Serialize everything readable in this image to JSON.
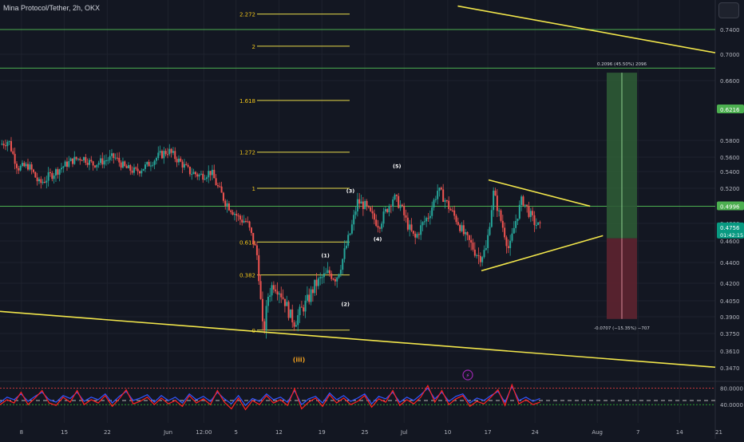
{
  "header": {
    "symbol": "Mina Protocol/Tether, 2h, OKX"
  },
  "colors": {
    "background": "#131722",
    "grid": "#1e222d",
    "green_line": "#4caf50",
    "yellow": "#f2e64b",
    "fib_line": "#e6d84a",
    "fib_text": "#f0c419",
    "candle_up": "#26a69a",
    "candle_down": "#ef5350",
    "profit_zone": "#2e5a35",
    "loss_zone": "#5e2430",
    "rsi_blue": "#3355ff",
    "rsi_red": "#ff2020",
    "axis_text": "#b2b5be"
  },
  "chart_data": [
    {
      "type": "candlestick",
      "title": "",
      "price_scale": {
        "ticks": [
          "0.7400",
          "0.7000",
          "0.6600",
          "0.5800",
          "0.5600",
          "0.5400",
          "0.5200",
          "0.4800",
          "0.4600",
          "0.4400",
          "0.4200",
          "0.4050",
          "0.3900",
          "0.3750",
          "0.3610",
          "0.3470"
        ],
        "badges": [
          {
            "label": "0.6216",
            "price": 0.6216,
            "color": "#4caf50"
          },
          {
            "label": "0.4996",
            "price": 0.4996,
            "color": "#4caf50"
          },
          {
            "label": "0.4756",
            "sub": "01:42:15",
            "price": 0.4756,
            "color": "#089981"
          }
        ]
      },
      "time_axis": {
        "ticks": [
          {
            "label": "8",
            "x": 0.03
          },
          {
            "label": "15",
            "x": 0.09
          },
          {
            "label": "22",
            "x": 0.15
          },
          {
            "label": "Jun",
            "x": 0.235
          },
          {
            "label": "12:00",
            "x": 0.285
          },
          {
            "label": "5",
            "x": 0.33
          },
          {
            "label": "12",
            "x": 0.39
          },
          {
            "label": "19",
            "x": 0.45
          },
          {
            "label": "25",
            "x": 0.51
          },
          {
            "label": "Jul",
            "x": 0.565
          },
          {
            "label": "10",
            "x": 0.626
          },
          {
            "label": "17",
            "x": 0.682
          },
          {
            "label": "24",
            "x": 0.748
          },
          {
            "label": "Aug",
            "x": 0.835
          },
          {
            "label": "7",
            "x": 0.892
          },
          {
            "label": "14",
            "x": 0.95
          },
          {
            "label": "21",
            "x": 1.005
          }
        ]
      },
      "price_path": [
        [
          0.0,
          0.575
        ],
        [
          0.012,
          0.58
        ],
        [
          0.025,
          0.545
        ],
        [
          0.04,
          0.548
        ],
        [
          0.055,
          0.525
        ],
        [
          0.07,
          0.535
        ],
        [
          0.085,
          0.545
        ],
        [
          0.1,
          0.555
        ],
        [
          0.115,
          0.56
        ],
        [
          0.13,
          0.55
        ],
        [
          0.145,
          0.555
        ],
        [
          0.16,
          0.56
        ],
        [
          0.175,
          0.545
        ],
        [
          0.19,
          0.54
        ],
        [
          0.205,
          0.548
        ],
        [
          0.22,
          0.56
        ],
        [
          0.235,
          0.568
        ],
        [
          0.25,
          0.555
        ],
        [
          0.265,
          0.54
        ],
        [
          0.28,
          0.535
        ],
        [
          0.295,
          0.54
        ],
        [
          0.305,
          0.52
        ],
        [
          0.315,
          0.505
        ],
        [
          0.325,
          0.495
        ],
        [
          0.335,
          0.485
        ],
        [
          0.345,
          0.482
        ],
        [
          0.36,
          0.445
        ],
        [
          0.368,
          0.372
        ],
        [
          0.375,
          0.41
        ],
        [
          0.382,
          0.42
        ],
        [
          0.39,
          0.415
        ],
        [
          0.398,
          0.405
        ],
        [
          0.405,
          0.392
        ],
        [
          0.412,
          0.385
        ],
        [
          0.42,
          0.395
        ],
        [
          0.43,
          0.405
        ],
        [
          0.44,
          0.418
        ],
        [
          0.45,
          0.425
        ],
        [
          0.46,
          0.43
        ],
        [
          0.47,
          0.425
        ],
        [
          0.48,
          0.445
        ],
        [
          0.49,
          0.47
        ],
        [
          0.5,
          0.505
        ],
        [
          0.51,
          0.5
        ],
        [
          0.52,
          0.488
        ],
        [
          0.53,
          0.478
        ],
        [
          0.54,
          0.495
        ],
        [
          0.55,
          0.51
        ],
        [
          0.56,
          0.5
        ],
        [
          0.57,
          0.478
        ],
        [
          0.58,
          0.462
        ],
        [
          0.59,
          0.478
        ],
        [
          0.6,
          0.49
        ],
        [
          0.612,
          0.518
        ],
        [
          0.62,
          0.51
        ],
        [
          0.63,
          0.495
        ],
        [
          0.64,
          0.482
        ],
        [
          0.65,
          0.465
        ],
        [
          0.66,
          0.455
        ],
        [
          0.67,
          0.445
        ],
        [
          0.68,
          0.452
        ],
        [
          0.69,
          0.515
        ],
        [
          0.698,
          0.49
        ],
        [
          0.705,
          0.47
        ],
        [
          0.712,
          0.45
        ],
        [
          0.72,
          0.48
        ],
        [
          0.73,
          0.508
        ],
        [
          0.738,
          0.495
        ],
        [
          0.746,
          0.482
        ],
        [
          0.755,
          0.475
        ]
      ],
      "green_lines": [
        0.74,
        0.679,
        0.4996
      ],
      "trendlines": [
        {
          "name": "upper-wedge-line",
          "from": [
            0.64,
            0.778
          ],
          "to": [
            1.0,
            0.7024
          ]
        },
        {
          "name": "lower-wedge-line",
          "from": [
            0.0,
            0.395
          ],
          "to": [
            1.0,
            0.3475
          ]
        },
        {
          "name": "triangle-upper",
          "from": [
            0.683,
            0.53
          ],
          "to": [
            0.825,
            0.4996
          ]
        },
        {
          "name": "triangle-lower",
          "from": [
            0.673,
            0.432
          ],
          "to": [
            0.843,
            0.466
          ]
        }
      ],
      "fib_levels": [
        {
          "label": "2.272",
          "price": 0.765
        },
        {
          "label": "2",
          "price": 0.713
        },
        {
          "label": "1.618",
          "price": 0.6335
        },
        {
          "label": "1.272",
          "price": 0.566
        },
        {
          "label": "1",
          "price": 0.52
        },
        {
          "label": "0.618",
          "price": 0.459
        },
        {
          "label": "0.382",
          "price": 0.428
        },
        {
          "label": "0",
          "price": 0.378
        }
      ],
      "wave_labels": [
        {
          "label": "(1)",
          "x": 0.455,
          "price": 0.445
        },
        {
          "label": "(2)",
          "x": 0.483,
          "price": 0.4
        },
        {
          "label": "(3)",
          "x": 0.49,
          "price": 0.515
        },
        {
          "label": "(4)",
          "x": 0.528,
          "price": 0.46
        },
        {
          "label": "(5)",
          "x": 0.555,
          "price": 0.545
        },
        {
          "label": "(iii)",
          "x": 0.418,
          "price": 0.352
        }
      ],
      "position_tool": {
        "entry": 0.463,
        "target": 0.672,
        "stop": 0.388,
        "x_from": 0.978,
        "x_to": 1.028,
        "profit_label": "0.2096 (45.50%) 2096",
        "loss_label": "-0.0707 (−15.35%) −707"
      }
    },
    {
      "type": "line",
      "title": "",
      "ticks": [
        "80.0000",
        "40.0000"
      ],
      "levels": [
        80,
        50,
        40
      ],
      "series": [
        {
          "color_key": "rsi_blue",
          "values": [
            45,
            58,
            52,
            66,
            48,
            60,
            70,
            52,
            46,
            62,
            55,
            70,
            48,
            58,
            52,
            66,
            44,
            60,
            72,
            50,
            56,
            64,
            46,
            62,
            50,
            58,
            44,
            66,
            52,
            60,
            48,
            70,
            54,
            42,
            62,
            38,
            55,
            48,
            66,
            52,
            58,
            46,
            74,
            40,
            54,
            60,
            44,
            68,
            52,
            62,
            48,
            56,
            66,
            42,
            60,
            54,
            70,
            46,
            58,
            50,
            64,
            80,
            54,
            70,
            48,
            60,
            66,
            44,
            56,
            50,
            62,
            72,
            46,
            84,
            50,
            58,
            48,
            55
          ]
        },
        {
          "color_key": "rsi_red",
          "values": [
            40,
            52,
            44,
            70,
            40,
            56,
            74,
            44,
            38,
            58,
            46,
            74,
            40,
            52,
            44,
            62,
            36,
            54,
            76,
            42,
            48,
            58,
            40,
            56,
            42,
            50,
            36,
            62,
            44,
            54,
            40,
            74,
            46,
            30,
            56,
            28,
            50,
            40,
            62,
            44,
            52,
            38,
            78,
            30,
            46,
            56,
            36,
            64,
            44,
            56,
            40,
            48,
            62,
            34,
            54,
            46,
            74,
            38,
            52,
            42,
            58,
            86,
            46,
            74,
            40,
            54,
            62,
            36,
            48,
            42,
            58,
            76,
            38,
            88,
            42,
            52,
            40,
            46
          ]
        }
      ],
      "badge_icon": "lightning-icon"
    }
  ]
}
